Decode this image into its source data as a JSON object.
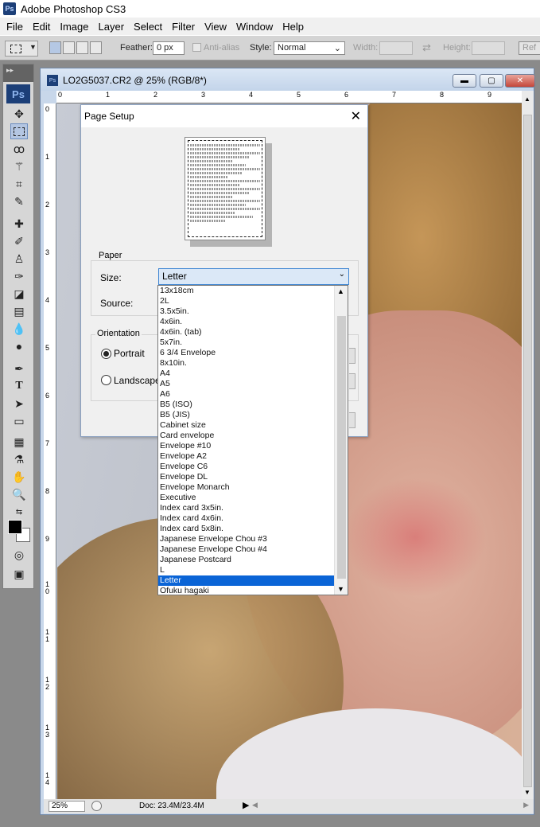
{
  "app": {
    "title": "Adobe Photoshop CS3",
    "badge": "Ps"
  },
  "menubar": [
    "File",
    "Edit",
    "Image",
    "Layer",
    "Select",
    "Filter",
    "View",
    "Window",
    "Help"
  ],
  "options": {
    "feather_label": "Feather:",
    "feather_value": "0 px",
    "antialias_label": "Anti-alias",
    "style_label": "Style:",
    "style_value": "Normal",
    "width_label": "Width:",
    "height_label": "Height:",
    "refine_label": "Ref"
  },
  "toolbox": {
    "logo": "Ps"
  },
  "document": {
    "title": "LO2G5037.CR2 @ 25% (RGB/8*)",
    "zoom": "25%",
    "doc_info": "Doc: 23.4M/23.4M",
    "ruler_h": [
      "0",
      "1",
      "2",
      "3",
      "4",
      "5",
      "6",
      "7",
      "8",
      "9"
    ],
    "ruler_v": [
      "0",
      "1",
      "2",
      "3",
      "4",
      "5",
      "6",
      "7",
      "8",
      "9",
      "1\n0",
      "1\n1",
      "1\n2",
      "1\n3",
      "1\n4"
    ]
  },
  "dialog": {
    "title": "Page Setup",
    "paper_group": "Paper",
    "size_label": "Size:",
    "size_value": "Letter",
    "source_label": "Source:",
    "orientation_group": "Orientation",
    "portrait_label": "Portrait",
    "landscape_label": "Landscape",
    "orientation_selected": "Portrait"
  },
  "paper_sizes": [
    "13x18cm",
    "2L",
    "3.5x5in.",
    "4x6in.",
    "4x6in. (tab)",
    "5x7in.",
    "6 3/4 Envelope",
    "8x10in.",
    "A4",
    "A5",
    "A6",
    "B5 (ISO)",
    "B5 (JIS)",
    "Cabinet size",
    "Card envelope",
    "Envelope #10",
    "Envelope A2",
    "Envelope C6",
    "Envelope DL",
    "Envelope Monarch",
    "Executive",
    "Index card 3x5in.",
    "Index card 4x6in.",
    "Index card 5x8in.",
    "Japanese Envelope Chou #3",
    "Japanese Envelope Chou #4",
    "Japanese Postcard",
    "L",
    "Letter",
    "Ofuku hagaki"
  ],
  "selected_paper_size": "Letter",
  "colors": {
    "accent": "#0a64d6",
    "combo_focus": "#dbe8f7"
  }
}
